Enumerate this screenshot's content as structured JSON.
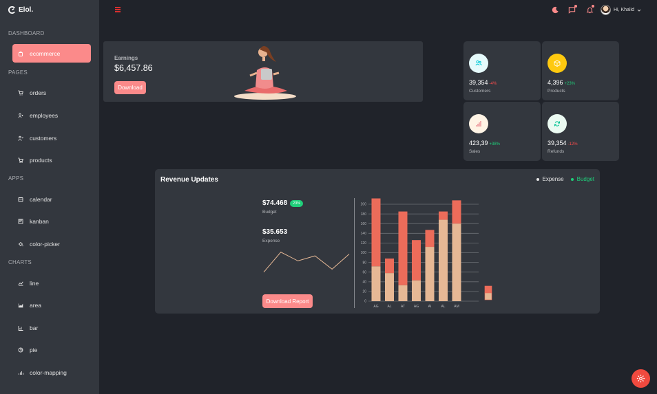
{
  "app": {
    "name": "Elol."
  },
  "sidebar": {
    "sections": [
      {
        "title": "DASHBOARD",
        "items": [
          {
            "label": "ecommerce",
            "icon": "shopping-bag-icon",
            "active": true
          }
        ]
      },
      {
        "title": "PAGES",
        "items": [
          {
            "label": "orders",
            "icon": "cart-icon"
          },
          {
            "label": "employees",
            "icon": "users-icon"
          },
          {
            "label": "customers",
            "icon": "user-check-icon"
          },
          {
            "label": "products",
            "icon": "cart-outline-icon"
          }
        ]
      },
      {
        "title": "APPS",
        "items": [
          {
            "label": "calendar",
            "icon": "calendar-icon"
          },
          {
            "label": "kanban",
            "icon": "kanban-icon"
          },
          {
            "label": "color-picker",
            "icon": "paint-bucket-icon"
          }
        ]
      },
      {
        "title": "CHARTS",
        "items": [
          {
            "label": "line",
            "icon": "line-chart-icon"
          },
          {
            "label": "area",
            "icon": "area-chart-icon"
          },
          {
            "label": "bar",
            "icon": "bar-chart-icon"
          },
          {
            "label": "pie",
            "icon": "pie-chart-icon"
          },
          {
            "label": "color-mapping",
            "icon": "stock-chart-icon"
          }
        ]
      }
    ]
  },
  "topbar": {
    "user_greeting": "Hi, Khalid"
  },
  "earnings": {
    "label": "Earnings",
    "amount": "$6,457.86",
    "button": "Download"
  },
  "stats": [
    {
      "value": "39,354",
      "pct": "-4%",
      "name": "Customers",
      "trend": "down",
      "icon": "users-icon",
      "icon_color": "#03c9d7",
      "icon_bg": "#e5fafb"
    },
    {
      "value": "4,396",
      "pct": "+23%",
      "name": "Products",
      "trend": "up",
      "icon": "box-icon",
      "icon_color": "#ffffff",
      "icon_bg": "#fec90f"
    },
    {
      "value": "423,39",
      "pct": "+38%",
      "name": "Sales",
      "trend": "up",
      "icon": "bar-chart-icon",
      "icon_color": "#e46a76",
      "icon_bg": "#fff4e5"
    },
    {
      "value": "39,354",
      "pct": "-12%",
      "name": "Refunds",
      "trend": "down",
      "icon": "refresh-icon",
      "icon_color": "#00c292",
      "icon_bg": "#ebfaf2"
    }
  ],
  "revenue": {
    "title": "Revenue Updates",
    "legend": [
      {
        "label": "Expense",
        "color": "#e6e6e6"
      },
      {
        "label": "Budget",
        "color": "#1fcf7a"
      }
    ],
    "budget": {
      "value": "$74.468",
      "badge": "23%",
      "label": "Budget"
    },
    "expense": {
      "value": "$35.653",
      "label": "Expense"
    },
    "button": "Download Report",
    "sparkline": [
      50,
      130,
      95,
      115,
      62,
      122
    ]
  },
  "colors": {
    "accent": "#fb8a8a",
    "up": "#1fcf7a",
    "down": "#ff4d4d"
  },
  "chart_data": {
    "type": "bar",
    "stacked": true,
    "categories": [
      "AG",
      "AL",
      "AT",
      "AG",
      "AI",
      "AL",
      "AM"
    ],
    "series": [
      {
        "name": "Budget",
        "color": "#e6b895",
        "values": [
          72,
          58,
          33,
          43,
          112,
          168,
          160
        ]
      },
      {
        "name": "Expense",
        "color": "#ec6c5a",
        "values": [
          140,
          30,
          152,
          83,
          35,
          17,
          48
        ]
      }
    ],
    "ylim": [
      0,
      200
    ],
    "yticks": [
      0,
      20,
      40,
      60,
      80,
      100,
      120,
      140,
      160,
      180,
      200
    ],
    "grid": true
  }
}
